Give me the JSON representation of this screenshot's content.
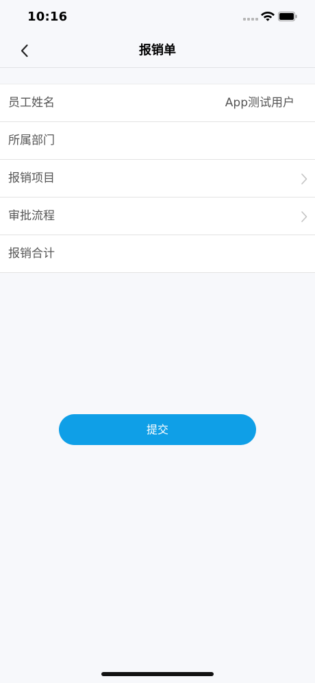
{
  "status_bar": {
    "time": "10:16"
  },
  "header": {
    "title": "报销单",
    "back_icon": "chevron-left-icon"
  },
  "form": {
    "rows": [
      {
        "label": "员工姓名",
        "value": "App测试用户",
        "chevron": false
      },
      {
        "label": "所属部门",
        "value": "",
        "chevron": false
      },
      {
        "label": "报销项目",
        "value": "",
        "chevron": true
      },
      {
        "label": "审批流程",
        "value": "",
        "chevron": true
      },
      {
        "label": "报销合计",
        "value": "",
        "chevron": false
      }
    ]
  },
  "actions": {
    "submit_label": "提交"
  },
  "colors": {
    "accent": "#0f9fe7",
    "background": "#f7f8fb",
    "text": "#555555"
  }
}
